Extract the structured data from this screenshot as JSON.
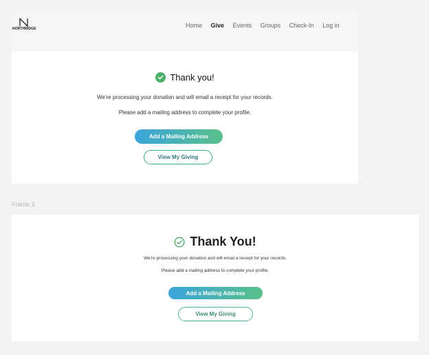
{
  "nav": {
    "logo_text": "NORTHRIDGE",
    "links": [
      "Home",
      "Give",
      "Events",
      "Groups",
      "Check-In",
      "Log in"
    ],
    "active": "Give"
  },
  "frame1": {
    "title": "Thank you!",
    "line1": "We're processing your donation and will email a receipt for your records.",
    "line2": "Please add a mailing address to complete your profile.",
    "primary_button": "Add a Mailing Address",
    "secondary_button": "View My Giving"
  },
  "frame3_label": "Frame 3",
  "frame3": {
    "title": "Thank You!",
    "line1": "We're processing your donation and will email a receipt for your records.",
    "line2": "Please add a mailing address to complete your profile.",
    "primary_button": "Add a Mailing Address",
    "secondary_button": "View My Giving"
  },
  "colors": {
    "success_green": "#4caf68",
    "gradient_start": "#3ba4dc",
    "gradient_end": "#59c08a",
    "outline": "#3aa88a"
  }
}
